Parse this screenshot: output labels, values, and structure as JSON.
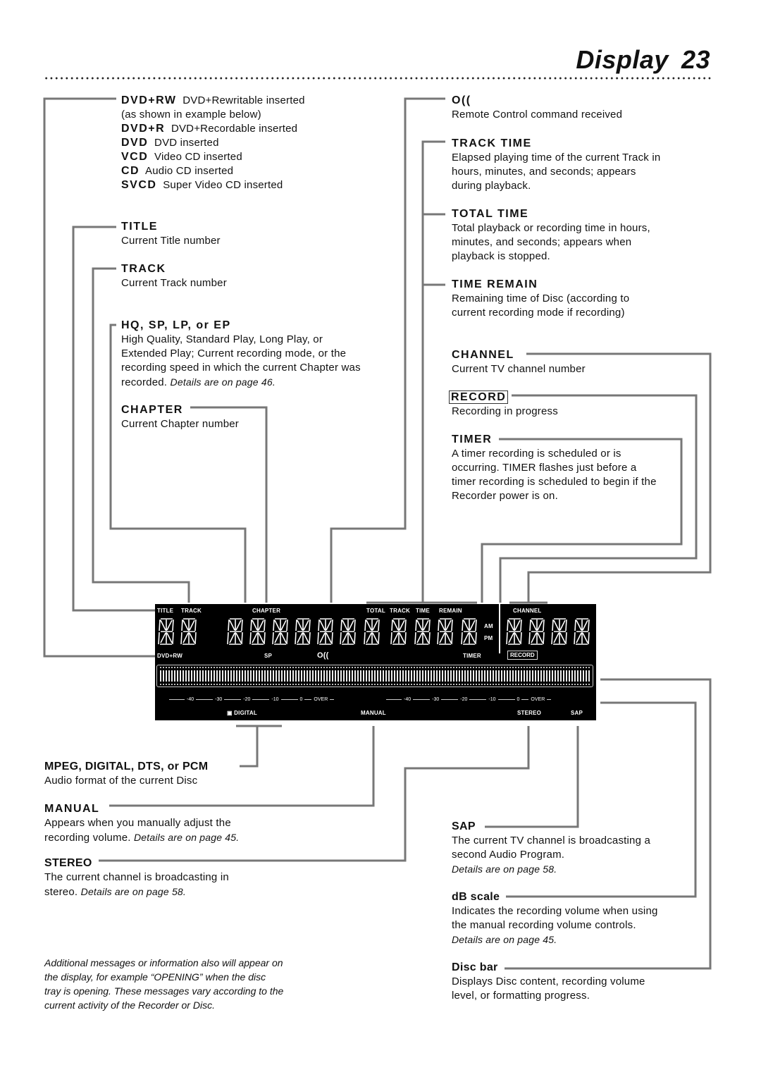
{
  "page": {
    "title": "Display",
    "number": "23"
  },
  "disc_types": [
    {
      "code": "DVD+RW",
      "desc": "DVD+Rewritable inserted"
    },
    {
      "code": "",
      "desc": "(as shown in example below)"
    },
    {
      "code": "DVD+R",
      "desc": "DVD+Recordable inserted"
    },
    {
      "code": "DVD",
      "desc": "DVD inserted"
    },
    {
      "code": "VCD",
      "desc": "Video CD inserted"
    },
    {
      "code": "CD",
      "desc": "Audio CD inserted"
    },
    {
      "code": "SVCD",
      "desc": "Super Video CD inserted"
    }
  ],
  "left": {
    "title": {
      "heading": "TITLE",
      "text": "Current Title number"
    },
    "track": {
      "heading": "TRACK",
      "text": "Current Track number"
    },
    "mode": {
      "heading": "HQ, SP, LP, or EP",
      "text": "High Quality, Standard Play, Long Play, or Extended Play; Current recording mode, or the recording speed in which the current Chapter was recorded.",
      "ref": "Details are on page 46."
    },
    "chapter": {
      "heading": "CHAPTER",
      "text": "Current Chapter number"
    }
  },
  "right": {
    "remote": {
      "heading": "O((",
      "text": "Remote Control command received"
    },
    "track_time": {
      "heading": "TRACK TIME",
      "text": "Elapsed playing time of the current Track in hours, minutes, and seconds; appears during playback."
    },
    "total_time": {
      "heading": "TOTAL TIME",
      "text": "Total playback or recording time in hours, minutes, and seconds; appears when playback is stopped."
    },
    "time_remain": {
      "heading": "TIME REMAIN",
      "text": "Remaining time of Disc (according to current recording mode if recording)"
    },
    "channel": {
      "heading": "CHANNEL",
      "text": "Current TV channel number"
    },
    "record": {
      "heading": "RECORD",
      "text": "Recording in progress"
    },
    "timer": {
      "heading": "TIMER",
      "text": "A timer recording is scheduled or is occurring. TIMER flashes just before a timer recording is scheduled to begin if the Recorder power is on."
    }
  },
  "bottom_left": {
    "audio": {
      "heading": "MPEG, DIGITAL, DTS, or PCM",
      "text": "Audio format of the current Disc"
    },
    "manual": {
      "heading": "MANUAL",
      "text": "Appears when you manually adjust the recording volume.",
      "ref": "Details are on page 45."
    },
    "stereo": {
      "heading": "STEREO",
      "text": "The current channel is broadcasting in stereo.",
      "ref": "Details are on page 58."
    }
  },
  "bottom_right": {
    "sap": {
      "heading": "SAP",
      "text": "The current TV channel is broadcasting a second Audio Program.",
      "ref": "Details are on page 58."
    },
    "db_scale": {
      "heading": "dB scale",
      "text": "Indicates the recording volume when using the manual recording volume controls.",
      "ref": "Details are on page 45."
    },
    "disc_bar": {
      "heading": "Disc bar",
      "text": "Displays Disc content, recording volume level, or formatting progress."
    }
  },
  "note": "Additional messages or information also will appear on the display, for example “OPENING” when the disc tray is opening.  These messages vary according to the current activity of the Recorder or Disc.",
  "lcd": {
    "labels": {
      "title": "TITLE",
      "track": "TRACK",
      "chapter": "CHAPTER",
      "total": "TOTAL",
      "track2": "TRACK",
      "time": "TIME",
      "remain": "REMAIN",
      "channel": "CHANNEL",
      "am": "AM",
      "pm": "PM",
      "disc": "DVD+RW",
      "sp": "SP",
      "remote": "O((",
      "timer": "TIMER",
      "record": "RECORD",
      "digital": "▣ DIGITAL",
      "manual": "MANUAL",
      "stereo": "STEREO",
      "sap": "SAP"
    },
    "scale": [
      "-40",
      "-30",
      "-20",
      "-10",
      "0",
      "OVER"
    ]
  }
}
